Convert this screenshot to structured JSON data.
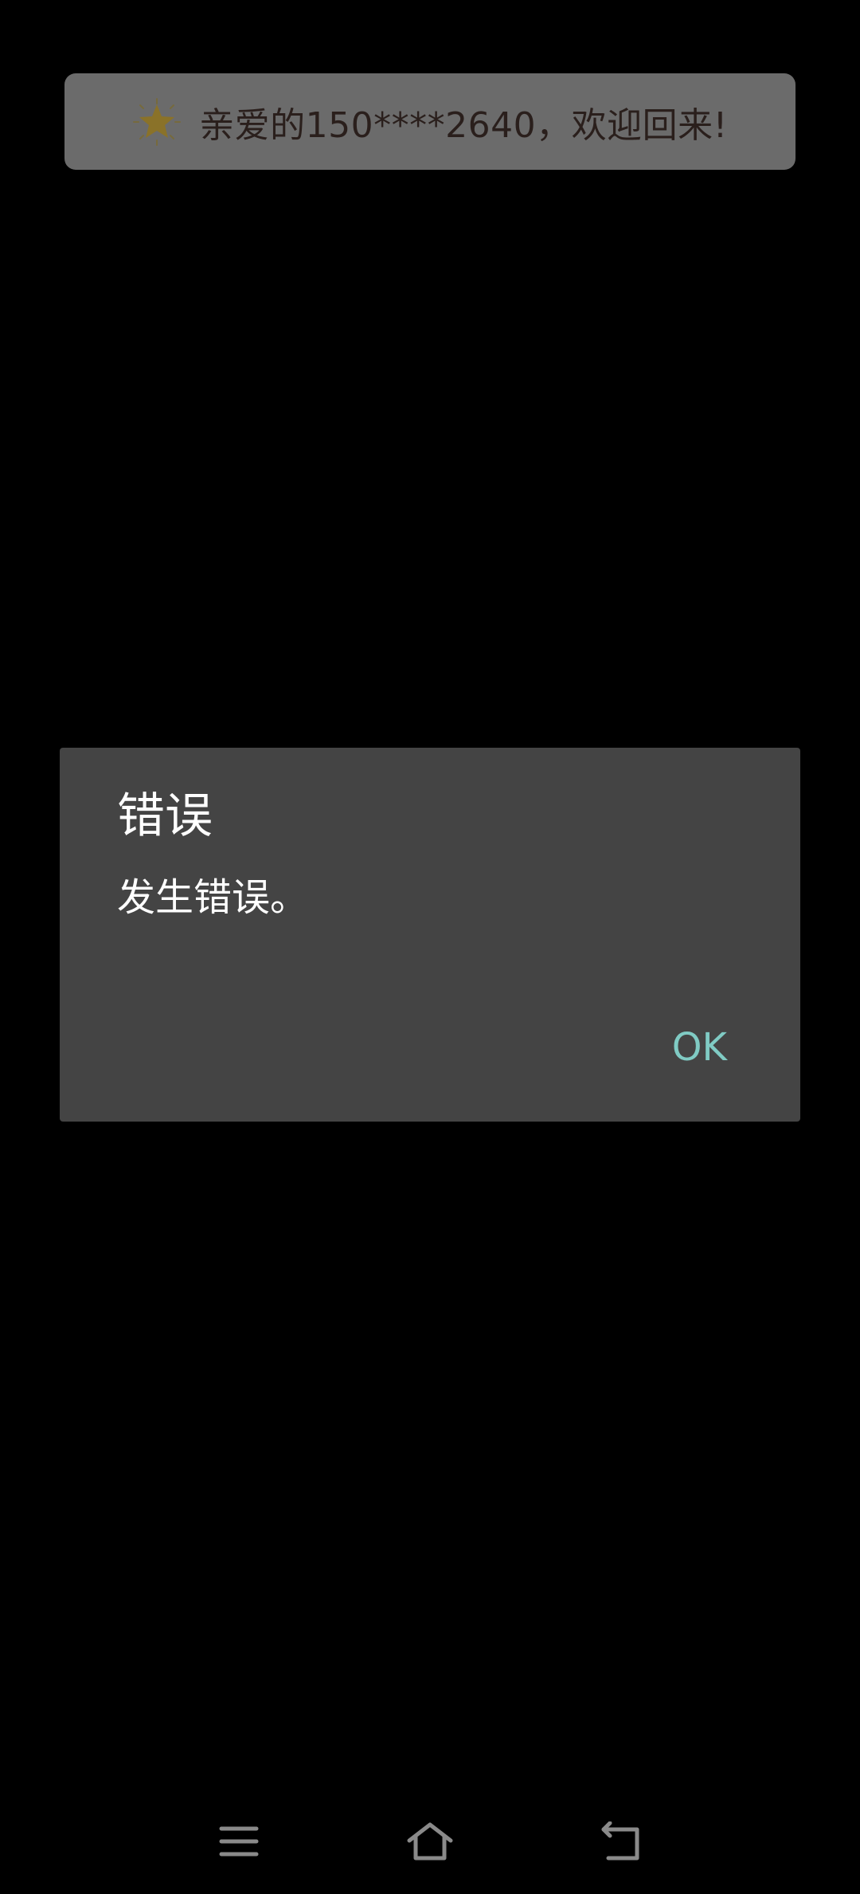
{
  "toast": {
    "icon": "star-icon",
    "text": "亲爱的150****2640，欢迎回来!"
  },
  "dialog": {
    "title": "错误",
    "message": "发生错误。",
    "ok_label": "OK",
    "accent_color": "#80cbc4"
  },
  "navbar": {
    "icons": [
      "menu-icon",
      "home-icon",
      "back-icon"
    ]
  }
}
